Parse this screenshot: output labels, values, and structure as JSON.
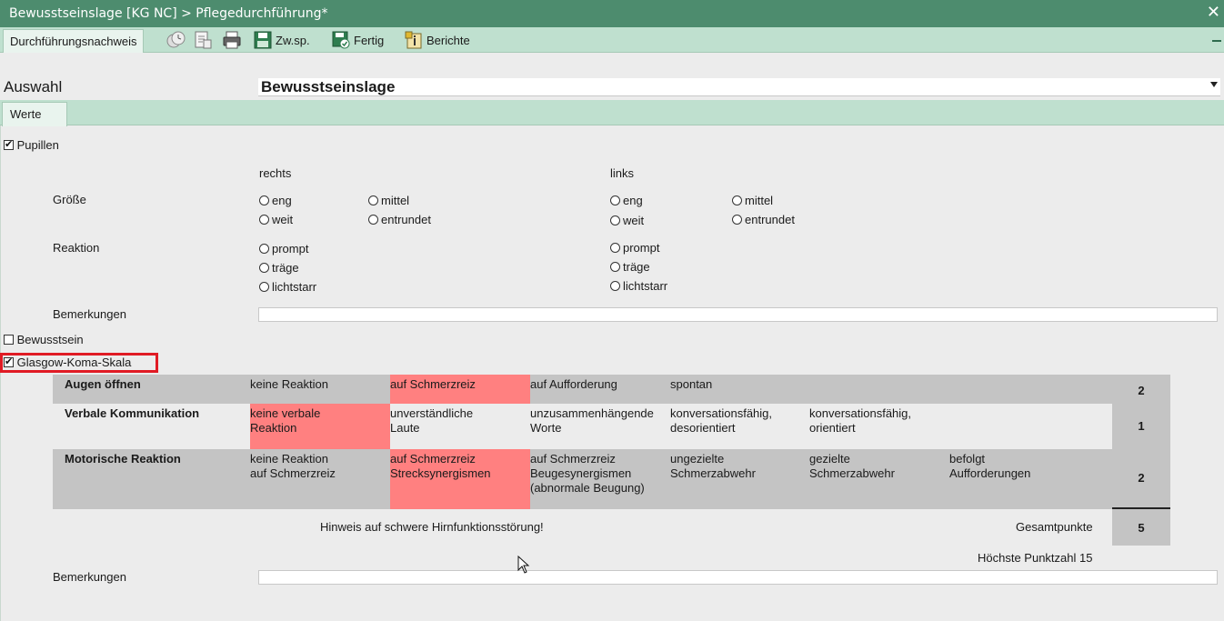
{
  "window": {
    "title": "Bewusstseinslage [KG NC] > Pflegedurchführung*",
    "close_label": "✕"
  },
  "toolbar": {
    "tab_label": "Durchführungsnachweis",
    "save_label": "Zw.sp.",
    "done_label": "Fertig",
    "reports_label": "Berichte"
  },
  "auswahl": {
    "label": "Auswahl",
    "value": "Bewusstseinslage"
  },
  "tabs": {
    "werte_label": "Werte"
  },
  "pupillen": {
    "label": "Pupillen",
    "checked": true,
    "col_right": "rechts",
    "col_left": "links",
    "groesse_label": "Größe",
    "groesse_options": [
      "eng",
      "mittel",
      "weit",
      "entrundet"
    ],
    "reaktion_label": "Reaktion",
    "reaktion_options": [
      "prompt",
      "träge",
      "lichtstarr"
    ],
    "bemerkungen_label": "Bemerkungen",
    "bemerkungen_value": ""
  },
  "bewusstsein": {
    "label": "Bewusstsein",
    "checked": false
  },
  "gcs": {
    "label": "Glasgow-Koma-Skala",
    "checked": true,
    "highlight_color": "#e01b24",
    "selected_color": "#ff8080",
    "rows": [
      {
        "title": "Augen öffnen",
        "options": [
          "keine Reaktion",
          "auf Schmerzreiz",
          "auf Aufforderung",
          "spontan"
        ],
        "selected": 1,
        "score": "2"
      },
      {
        "title": "Verbale Kommunikation",
        "options": [
          "keine verbale\nReaktion",
          "unverständliche\nLaute",
          "unzusammenhängende\nWorte",
          "konversationsfähig,\ndesorientiert",
          "konversationsfähig,\norientiert"
        ],
        "selected": 0,
        "score": "1"
      },
      {
        "title": "Motorische Reaktion",
        "options": [
          "keine Reaktion\nauf Schmerzreiz",
          "auf Schmerzreiz\nStrecksynergismen",
          "auf Schmerzreiz\nBeugesynergismen\n(abnormale Beugung)",
          "ungezielte\nSchmerzabwehr",
          "gezielte\nSchmerzabwehr",
          "befolgt\nAufforderungen"
        ],
        "selected": 1,
        "score": "2"
      }
    ],
    "hint": "Hinweis auf schwere Hirnfunktionsstörung!",
    "total_label": "Gesamtpunkte",
    "total": "5",
    "max_label": "Höchste Punktzahl 15",
    "bemerkungen_label": "Bemerkungen",
    "bemerkungen_value": ""
  }
}
